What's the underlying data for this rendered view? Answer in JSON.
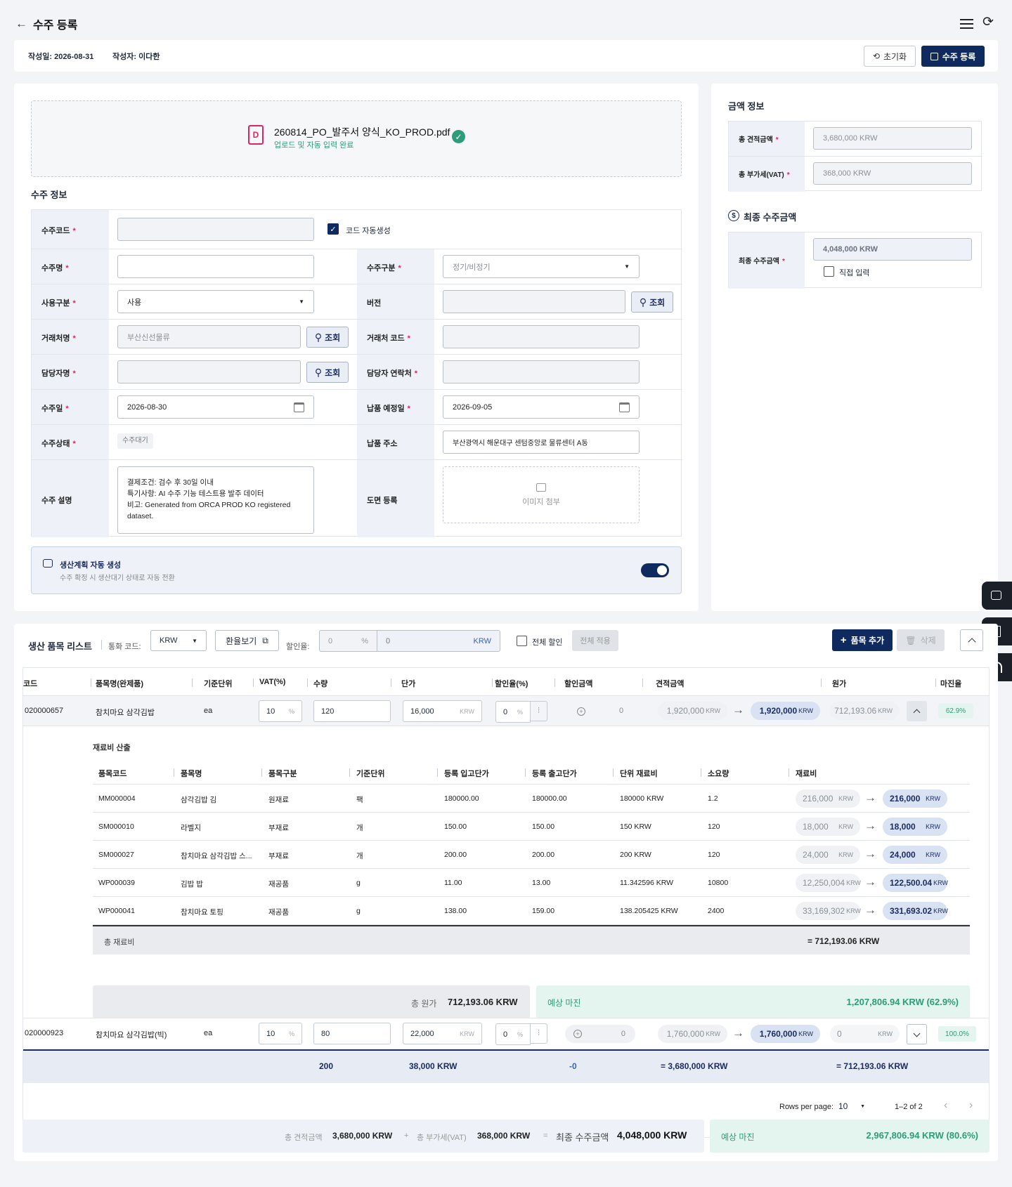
{
  "header": {
    "title": "수주 등록",
    "meta_date": "작성일: 2026-08-31",
    "meta_author": "작성자: 이다한",
    "reset_label": "초기화",
    "register_label": "수주 등록"
  },
  "upload": {
    "filename": "260814_PO_발주서 양식_KO_PROD.pdf",
    "status": "업로드 및 자동 입력 완료"
  },
  "order_info": {
    "section_title": "수주 정보",
    "code_label": "수주코드",
    "auto_code_label": "코드 자동생성",
    "name_label": "수주명",
    "type_label": "수주구분",
    "type_placeholder": "정기/비정기",
    "use_label": "사용구분",
    "use_value": "사용",
    "version_label": "버전",
    "client_label": "거래처명",
    "client_value": "부산신선물류",
    "client_code_label": "거래처 코드",
    "manager_label": "담당자명",
    "manager_contact_label": "담당자 연락처",
    "order_date_label": "수주일",
    "order_date_value": "2026-08-30",
    "delivery_date_label": "납품 예정일",
    "delivery_date_value": "2026-09-05",
    "status_label": "수주상태",
    "status_value": "수주대기",
    "address_label": "납품 주소",
    "address_value": "부산광역시 해운대구 센텀중앙로 물류센터 A동",
    "desc_label": "수주 설명",
    "desc_lines": [
      "결제조건: 검수 후 30일 이내",
      "특기사항: AI 수주 기능 테스트용 발주 데이터",
      "비고: Generated from ORCA PROD KO registered",
      "dataset."
    ],
    "drawing_label": "도면 등록",
    "image_attach_label": "이미지 첨부",
    "search_label": "조회"
  },
  "auto_plan": {
    "title": "생산계획 자동 생성",
    "desc": "수주 확정 시 생산대기 상태로 자동 전환",
    "enabled": true
  },
  "amount": {
    "title": "금액 정보",
    "total_quote_label": "총 견적금액",
    "total_quote_value": "3,680,000 KRW",
    "total_vat_label": "총 부가세(VAT)",
    "total_vat_value": "368,000 KRW",
    "final_title": "최종 수주금액",
    "final_label": "최종 수주금액",
    "final_value": "4,048,000 KRW",
    "direct_input_label": "직접 입력"
  },
  "items": {
    "title": "생산 품목 리스트",
    "currency_label": "통화 코드:",
    "currency_value": "KRW",
    "exchange_label": "환율보기",
    "discount_label": "할인율:",
    "discount_pct": "0",
    "pct_sign": "%",
    "discount_amt": "0",
    "krw": "KRW",
    "all_discount_label": "전체 할인",
    "apply_all_label": "전체 적용",
    "add_label": "품목 추가",
    "delete_label": "삭제",
    "columns": [
      "코드",
      "품목명(완제품)",
      "기준단위",
      "VAT(%)",
      "수량",
      "단가",
      "할인율(%)",
      "할인금액",
      "견적금액",
      "원가",
      "마진율"
    ],
    "rows": [
      {
        "code": "020000657",
        "name": "참치마요 삼각김밥",
        "unit": "ea",
        "vat": "10",
        "qty": "120",
        "price": "16,000",
        "disc": "0",
        "disc_amt": "0",
        "quote_from": "1,920,000",
        "quote_to": "1,920,000",
        "cost": "712,193.06",
        "margin": "62.9%"
      },
      {
        "code": "020000923",
        "name": "참치마요 삼각김밥(빅)",
        "unit": "ea",
        "vat": "10",
        "qty": "80",
        "price": "22,000",
        "disc": "0",
        "disc_amt": "0",
        "quote_from": "1,760,000",
        "quote_to": "1,760,000",
        "cost": "0",
        "margin": "100.0%"
      }
    ],
    "totals": {
      "qty": "200",
      "price": "38,000 KRW",
      "disc": "-0",
      "quote": "= 3,680,000 KRW",
      "cost": "= 712,193.06 KRW"
    },
    "pagination": {
      "rows_per_page_label": "Rows per page:",
      "rows_per_page": "10",
      "range": "1–2 of 2"
    }
  },
  "material": {
    "title": "재료비 산출",
    "columns": [
      "품목코드",
      "품목명",
      "품목구분",
      "기준단위",
      "등록 입고단가",
      "등록 출고단가",
      "단위 재료비",
      "소요량",
      "재료비"
    ],
    "rows": [
      {
        "code": "MM000004",
        "name": "삼각김밥 김",
        "type": "원재료",
        "unit": "팩",
        "in": "180000.00",
        "out": "180000.00",
        "unit_cost": "180000 KRW",
        "req": "1.2",
        "from": "216,000",
        "to": "216,000"
      },
      {
        "code": "SM000010",
        "name": "라벨지",
        "type": "부재료",
        "unit": "개",
        "in": "150.00",
        "out": "150.00",
        "unit_cost": "150 KRW",
        "req": "120",
        "from": "18,000",
        "to": "18,000"
      },
      {
        "code": "SM000027",
        "name": "참치마요 삼각김밥 스...",
        "type": "부재료",
        "unit": "개",
        "in": "200.00",
        "out": "200.00",
        "unit_cost": "200 KRW",
        "req": "120",
        "from": "24,000",
        "to": "24,000"
      },
      {
        "code": "WP000039",
        "name": "김밥 밥",
        "type": "재공품",
        "unit": "g",
        "in": "11.00",
        "out": "13.00",
        "unit_cost": "11.342596 KRW",
        "req": "10800",
        "from": "12,250,004",
        "to": "122,500.04"
      },
      {
        "code": "WP000041",
        "name": "참치마요 토핑",
        "type": "재공품",
        "unit": "g",
        "in": "138.00",
        "out": "159.00",
        "unit_cost": "138.205425 KRW",
        "req": "2400",
        "from": "33,169,302",
        "to": "331,693.02"
      }
    ],
    "total_label": "총 재료비",
    "total_value": "= 712,193.06 KRW",
    "cost_label": "총 원가",
    "cost_value": "712,193.06 KRW",
    "margin_label": "예상 마진",
    "margin_value": "1,207,806.94 KRW (62.9%)"
  },
  "footer": {
    "quote_label": "총 견적금액",
    "quote_value": "3,680,000 KRW",
    "plus": "+",
    "vat_label": "총 부가세(VAT)",
    "vat_value": "368,000 KRW",
    "eq": "=",
    "final_label": "최종 수주금액",
    "final_value": "4,048,000 KRW",
    "margin_label": "예상 마진",
    "margin_value": "2,967,806.94 KRW (80.6%)"
  },
  "colors": {
    "navy": "#0f2a5e",
    "teal": "#2d9d78",
    "red": "#e0245e"
  }
}
